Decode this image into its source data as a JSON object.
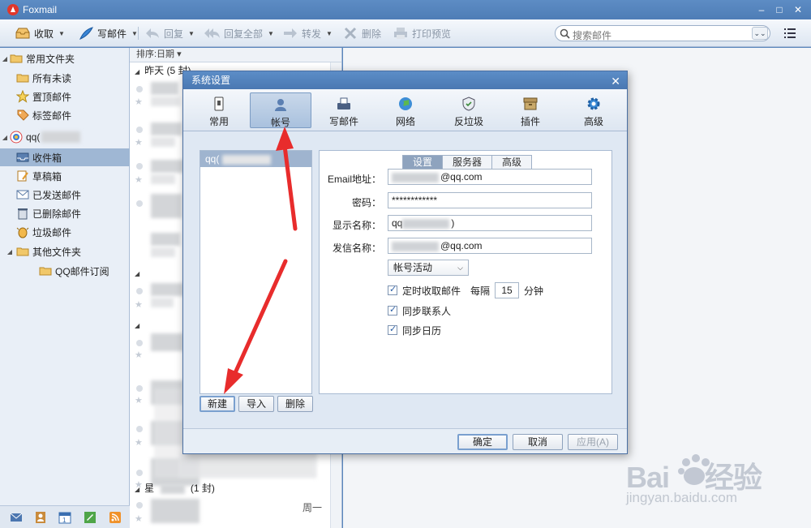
{
  "app": {
    "title": "Foxmail"
  },
  "toolbar": {
    "receive": "收取",
    "compose": "写邮件",
    "reply": "回复",
    "reply_all": "回复全部",
    "forward": "转发",
    "delete": "删除",
    "print_preview": "打印预览",
    "search_placeholder": "搜索邮件"
  },
  "sidebar": {
    "items": [
      {
        "label": "常用文件夹"
      },
      {
        "label": "所有未读"
      },
      {
        "label": "置顶邮件"
      },
      {
        "label": "标签邮件"
      },
      {
        "label": "qq("
      },
      {
        "label": "收件箱"
      },
      {
        "label": "草稿箱"
      },
      {
        "label": "已发送邮件"
      },
      {
        "label": "已删除邮件"
      },
      {
        "label": "垃圾邮件"
      },
      {
        "label": "其他文件夹"
      },
      {
        "label": "QQ邮件订阅"
      }
    ]
  },
  "list": {
    "sort_label": "排序:日期 ▾",
    "group_yesterday": "昨天 (5 封)",
    "group_bottom": "星",
    "group_bottom_count": "(1 封)",
    "bottom_date": "周一"
  },
  "dialog": {
    "title": "系统设置",
    "tabs": [
      {
        "label": "常用"
      },
      {
        "label": "帐号"
      },
      {
        "label": "写邮件"
      },
      {
        "label": "网络"
      },
      {
        "label": "反垃圾"
      },
      {
        "label": "插件"
      },
      {
        "label": "高级"
      }
    ],
    "account_item": "qq(",
    "buttons": {
      "new": "新建",
      "import": "导入",
      "delete": "删除"
    },
    "subtabs": [
      {
        "label": "设置"
      },
      {
        "label": "服务器"
      },
      {
        "label": "高级"
      }
    ],
    "fields": {
      "email_label": "Email地址：",
      "email_value": "@qq.com",
      "password_label": "密码：",
      "password_value": "************",
      "display_label": "显示名称：",
      "display_value_prefix": "qq",
      "display_value_suffix": ")",
      "sender_label": "发信名称：",
      "sender_value": "@qq.com"
    },
    "status_select": "帐号活动",
    "auto_receive": "定时收取邮件",
    "every": "每隔",
    "interval": "15",
    "minutes": "分钟",
    "sync_contacts": "同步联系人",
    "sync_calendar": "同步日历",
    "footer": {
      "ok": "确定",
      "cancel": "取消",
      "apply": "应用(A)"
    }
  },
  "watermark": {
    "brand": "Bai",
    "brand_cn": "经验",
    "url": "jingyan.baidu.com"
  }
}
